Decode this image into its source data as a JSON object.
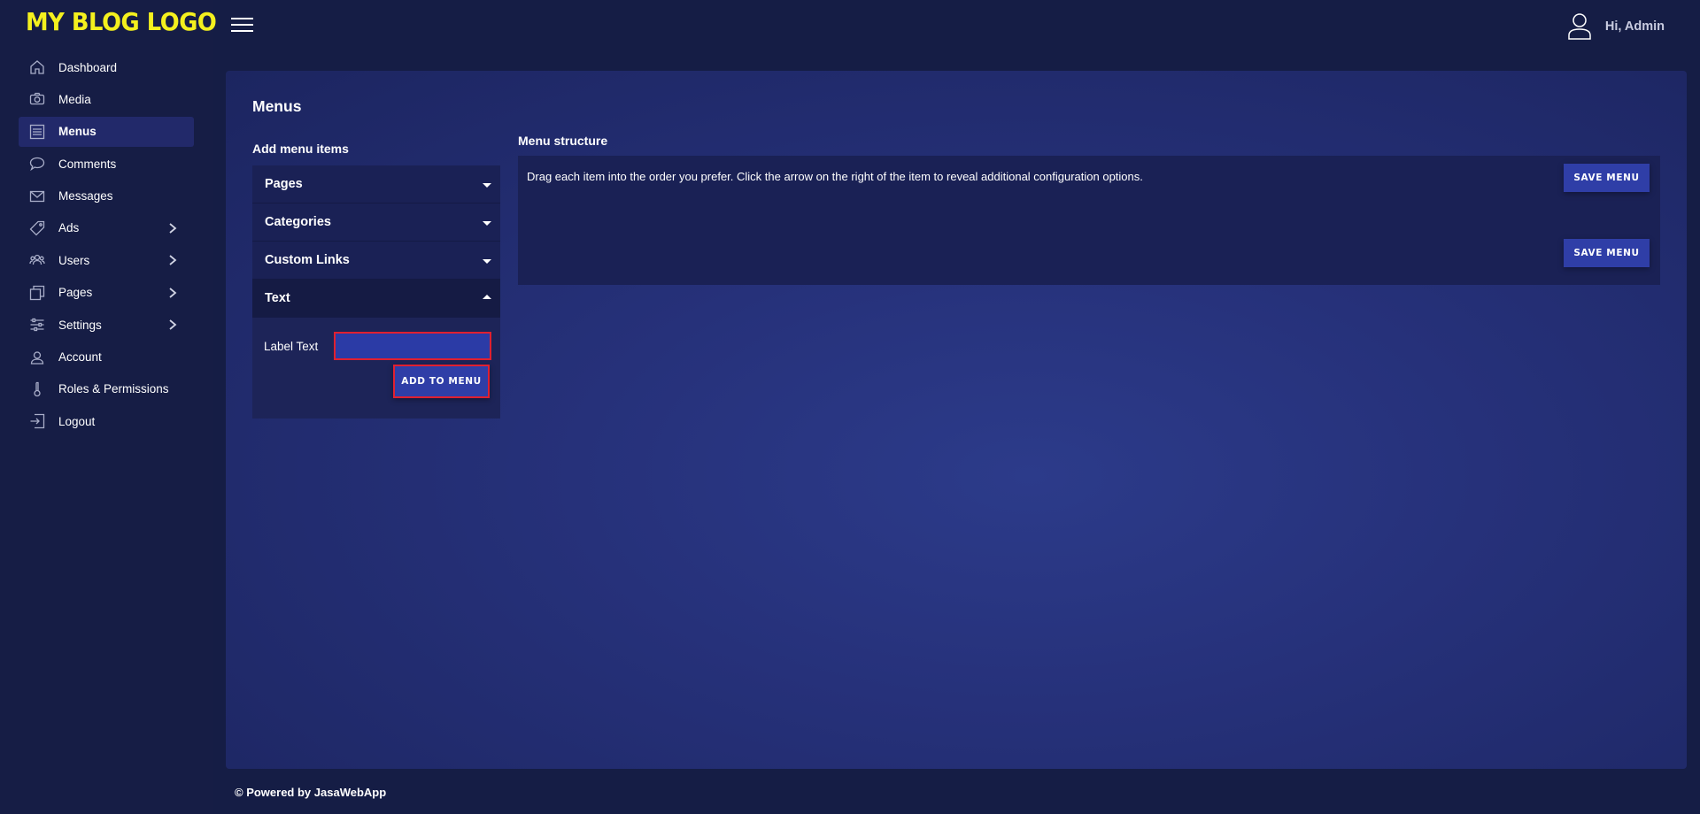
{
  "brand": {
    "logo_text": "MY BLOG LOGO",
    "logo_color": "#f4f01e"
  },
  "sidebar": {
    "items": [
      {
        "label": "Dashboard",
        "icon": "home-icon",
        "active": false,
        "has_submenu": false
      },
      {
        "label": "Media",
        "icon": "camera-icon",
        "active": false,
        "has_submenu": false
      },
      {
        "label": "Menus",
        "icon": "menu-list-icon",
        "active": true,
        "has_submenu": false
      },
      {
        "label": "Comments",
        "icon": "comment-icon",
        "active": false,
        "has_submenu": false
      },
      {
        "label": "Messages",
        "icon": "envelope-icon",
        "active": false,
        "has_submenu": false
      },
      {
        "label": "Ads",
        "icon": "tag-icon",
        "active": false,
        "has_submenu": true
      },
      {
        "label": "Users",
        "icon": "users-icon",
        "active": false,
        "has_submenu": true
      },
      {
        "label": "Pages",
        "icon": "pages-icon",
        "active": false,
        "has_submenu": true
      },
      {
        "label": "Settings",
        "icon": "sliders-icon",
        "active": false,
        "has_submenu": true
      },
      {
        "label": "Account",
        "icon": "user-icon",
        "active": false,
        "has_submenu": false
      },
      {
        "label": "Roles & Permissions",
        "icon": "key-icon",
        "active": false,
        "has_submenu": false
      },
      {
        "label": "Logout",
        "icon": "logout-icon",
        "active": false,
        "has_submenu": false
      }
    ]
  },
  "header": {
    "greeting": "Hi, Admin"
  },
  "main": {
    "title": "Menus",
    "add_items": {
      "heading": "Add menu items",
      "sections": [
        {
          "label": "Pages",
          "expanded": false
        },
        {
          "label": "Categories",
          "expanded": false
        },
        {
          "label": "Custom Links",
          "expanded": false
        },
        {
          "label": "Text",
          "expanded": true
        }
      ],
      "text_form": {
        "label": "Label Text",
        "input_value": "",
        "input_placeholder": "",
        "button_label": "ADD TO MENU"
      }
    },
    "structure": {
      "heading": "Menu structure",
      "hint": "Drag each item into the order you prefer. Click the arrow on the right of the item to reveal additional configuration options.",
      "save_top_label": "SAVE MENU",
      "save_bottom_label": "SAVE MENU"
    }
  },
  "footer": {
    "text": "© Powered by JasaWebApp"
  },
  "colors": {
    "background": "#151d45",
    "panel": "#1a2155",
    "accent_button": "#2f3ea7",
    "highlight_border": "#e02030",
    "active_nav": "#22296a"
  }
}
